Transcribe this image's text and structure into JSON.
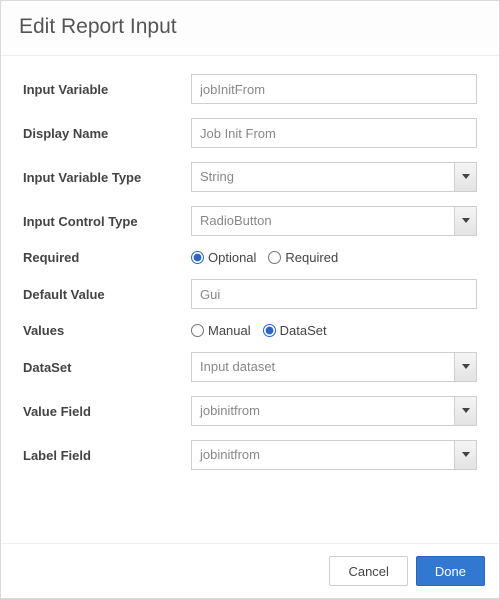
{
  "dialog": {
    "title": "Edit Report Input"
  },
  "labels": {
    "input_variable": "Input Variable",
    "display_name": "Display Name",
    "input_variable_type": "Input Variable Type",
    "input_control_type": "Input Control Type",
    "required": "Required",
    "default_value": "Default Value",
    "values": "Values",
    "dataset": "DataSet",
    "value_field": "Value Field",
    "label_field": "Label Field"
  },
  "fields": {
    "input_variable": "jobInitFrom",
    "display_name": "Job Init From",
    "input_variable_type": "String",
    "input_control_type": "RadioButton",
    "required_options": {
      "optional": "Optional",
      "required": "Required",
      "selected": "optional"
    },
    "default_value": "Gui",
    "values_options": {
      "manual": "Manual",
      "dataset": "DataSet",
      "selected": "dataset"
    },
    "dataset": "Input dataset",
    "value_field": "jobinitfrom",
    "label_field": "jobinitfrom"
  },
  "footer": {
    "cancel": "Cancel",
    "done": "Done"
  }
}
